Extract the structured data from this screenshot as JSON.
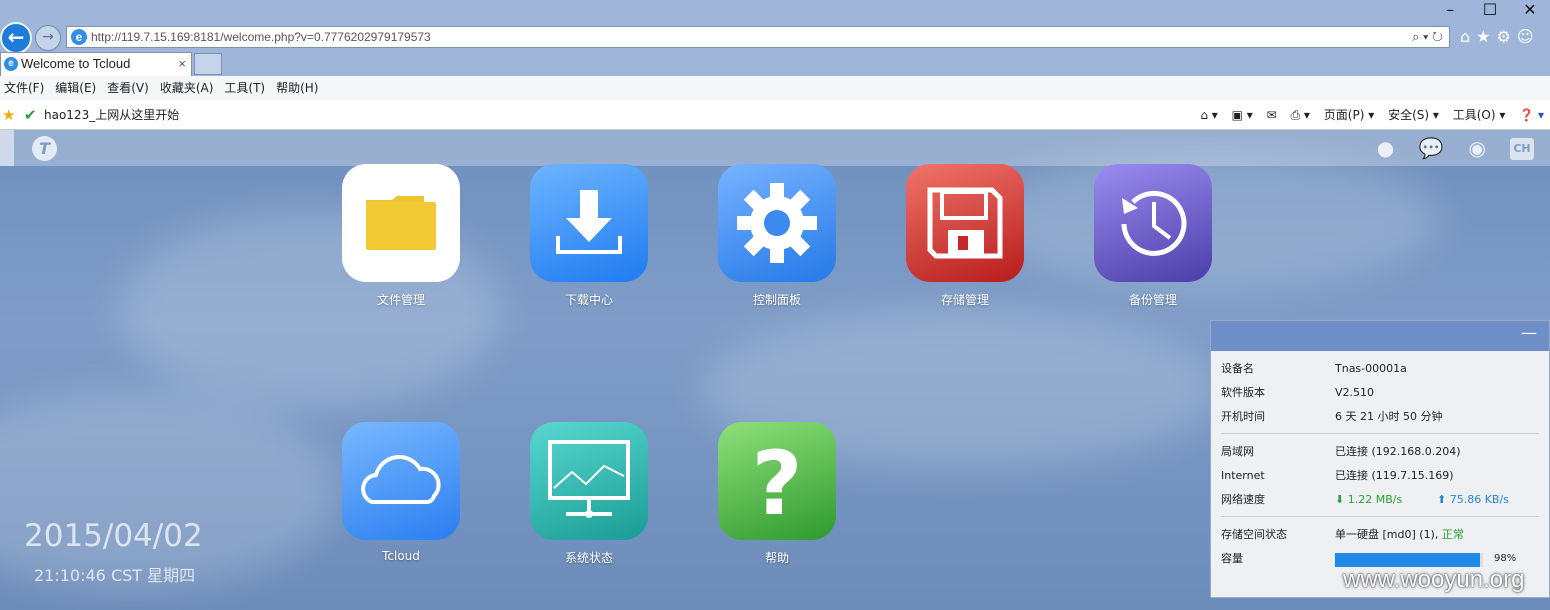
{
  "browser": {
    "url": "http://119.7.15.169:8181/welcome.php?v=0.7776202979179573",
    "tab_title": "Welcome to Tcloud",
    "tab_close": "×",
    "menu": [
      "文件(F)",
      "编辑(E)",
      "查看(V)",
      "收藏夹(A)",
      "工具(T)",
      "帮助(H)"
    ],
    "favorite_link": "hao123_上网从这里开始",
    "cmd_page": "页面(P) ▾",
    "cmd_safety": "安全(S) ▾",
    "cmd_tools": "工具(O) ▾"
  },
  "apps": [
    {
      "label": "文件管理",
      "icon": "folder-icon"
    },
    {
      "label": "下载中心",
      "icon": "download-icon"
    },
    {
      "label": "控制面板",
      "icon": "gear-icon"
    },
    {
      "label": "存储管理",
      "icon": "floppy-disk-icon"
    },
    {
      "label": "备份管理",
      "icon": "clock-history-icon"
    },
    {
      "label": "Tcloud",
      "icon": "cloud-icon"
    },
    {
      "label": "系统状态",
      "icon": "monitor-chart-icon"
    },
    {
      "label": "帮助",
      "icon": "question-mark-icon"
    }
  ],
  "topbar": {
    "lang": "CH"
  },
  "clock": {
    "date": "2015/04/02",
    "time": "21:10:46 CST 星期四"
  },
  "status": {
    "device_name_label": "设备名",
    "device_name": "Tnas-00001a",
    "software_label": "软件版本",
    "software": "V2.510",
    "uptime_label": "开机时间",
    "uptime": "6 天 21 小时 50 分钟",
    "lan_label": "局域网",
    "lan": "已连接 (192.168.0.204)",
    "internet_label": "Internet",
    "internet": "已连接 (119.7.15.169)",
    "speed_label": "网络速度",
    "down": "1.22 MB/s",
    "up": "75.86 KB/s",
    "storage_label": "存储空间状态",
    "storage": "单一硬盘 [md0] (1),",
    "storage_state": "正常",
    "capacity_label": "容量",
    "capacity_pct": "98%",
    "capacity_fraction": 0.98
  },
  "watermark": "www.wooyun.org"
}
